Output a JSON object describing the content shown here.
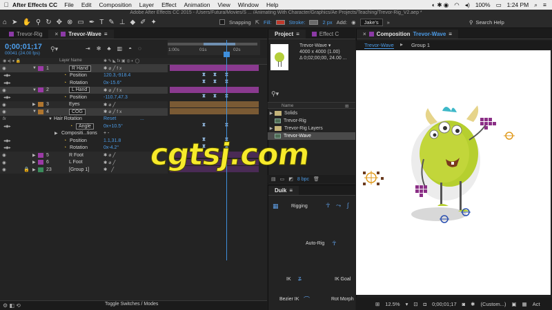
{
  "menubar": {
    "app": "After Effects CC",
    "items": [
      "File",
      "Edit",
      "Composition",
      "Layer",
      "Effect",
      "Animation",
      "View",
      "Window",
      "Help"
    ],
    "battery": "100%",
    "clock": "1:24 PM"
  },
  "window_title": "Adobe After Effects CC 2015 - /Users/Futura/Movies/S ... /Animating With Character/Graphics/Ae Projects/Teaching/Trevor-Rig_V2.aep *",
  "toolbar": {
    "snapping": "Snapping",
    "fill": "Fill:",
    "stroke": "Stroke:",
    "stroke_width": "2 px",
    "add": "Add:",
    "workspace": "Jake's",
    "search_help": "Search Help"
  },
  "timeline": {
    "tabs": [
      {
        "label": "Trevor-Rig",
        "active": false
      },
      {
        "label": "Trevor-Wave",
        "active": true
      }
    ],
    "timecode": "0;00;01;17",
    "frames": "00041 (24.00 fps)",
    "ruler_labels": [
      "1:00s",
      "01s",
      "02s"
    ],
    "column_header": {
      "layer_name": "Layer Name"
    },
    "rows": [
      {
        "num": "1",
        "name": "R Hand",
        "type": "layer",
        "color": "#9b3aa6",
        "bar_color": "#8a3a8f"
      },
      {
        "prop": "Position",
        "value": "120.3,-918.4"
      },
      {
        "prop": "Rotation",
        "value": "0x-15.6°"
      },
      {
        "num": "2",
        "name": "L Hand",
        "type": "layer",
        "color": "#9b3aa6",
        "bar_color": "#8a3a8f"
      },
      {
        "prop": "Position",
        "value": "-110.7,47.3"
      },
      {
        "num": "3",
        "name": "Eyes",
        "type": "layer",
        "color": "#b0762f",
        "bar_color": "#7a5a34"
      },
      {
        "num": "4",
        "name": "COG",
        "type": "layer",
        "color": "#b0762f",
        "bar_color": "#7a5a34"
      },
      {
        "effect": "Hair Rotation",
        "value": "Reset",
        "extra": "..."
      },
      {
        "prop": "Angle",
        "value": "0x+10.5°"
      },
      {
        "prop": "Compositi...tions",
        "value": "+ -"
      },
      {
        "prop": "Position",
        "value": "1.1,31.8"
      },
      {
        "prop": "Rotation",
        "value": "0x-4.2°"
      },
      {
        "num": "5",
        "name": "R Foot",
        "type": "layer",
        "color": "#9b3aa6",
        "bar_color": "#5d2f66"
      },
      {
        "num": "6",
        "name": "L Foot",
        "type": "layer",
        "color": "#9b3aa6",
        "bar_color": "#5d2f66"
      },
      {
        "num": "23",
        "name": "[Group 1]",
        "type": "layer",
        "color": "#3a8a5a",
        "bar_color": "#5d2f66"
      }
    ],
    "toggle_label": "Toggle Switches / Modes"
  },
  "project": {
    "tabs": [
      "Project",
      "Effect C"
    ],
    "selected_name": "Trevor-Wave ▾",
    "info_size": "4000 x 4000 (1.00)",
    "info_duration": "Δ 0;02;00;00, 24.00 ...",
    "column_name": "Name",
    "items": [
      {
        "label": "Solids",
        "kind": "folder",
        "arrow": "▶"
      },
      {
        "label": "Trevor-Rig",
        "kind": "comp",
        "arrow": ""
      },
      {
        "label": "Trevor-Rig Layers",
        "kind": "folder",
        "arrow": "▶"
      },
      {
        "label": "Trevor-Wave",
        "kind": "comp",
        "arrow": "",
        "selected": true
      }
    ],
    "bpc": "8 bpc"
  },
  "duik": {
    "title": "Duik",
    "rigging": "Rigging",
    "auto_rig": "Auto-Rig",
    "ik": "IK",
    "ik_goal": "IK Goal",
    "bezier_ik": "Bezier IK",
    "rot_morph": "Rot Morph"
  },
  "composition": {
    "tab": "Composition",
    "tab_name": "Trevor-Wave",
    "breadcrumb_active": "Trevor-Wave",
    "breadcrumb_child": "Group 1",
    "zoom": "12.5%",
    "time": "0;00;01;17",
    "view": "(Custom...)",
    "active": "Act"
  },
  "watermark": "www.cgtsj.com",
  "watermark_visible": "cgtsj.com"
}
